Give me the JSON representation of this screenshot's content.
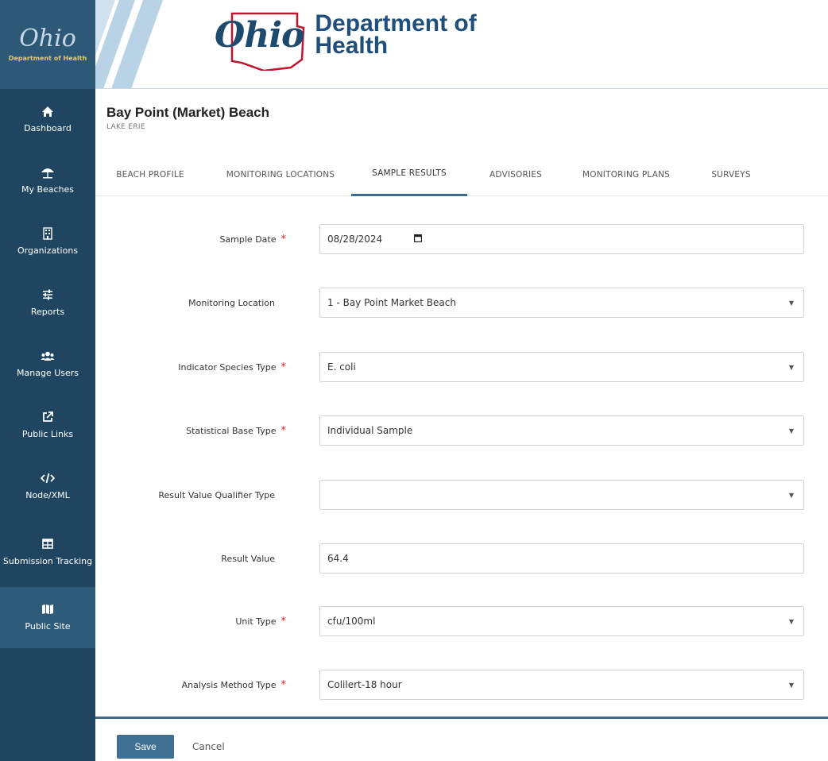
{
  "sidebar": {
    "logo_word": "Ohio",
    "logo_sub": "Department of Health",
    "items": [
      {
        "label": "Dashboard",
        "icon": "home-icon"
      },
      {
        "label": "My Beaches",
        "icon": "umbrella-icon"
      },
      {
        "label": "Organizations",
        "icon": "building-icon"
      },
      {
        "label": "Reports",
        "icon": "sliders-icon"
      },
      {
        "label": "Manage Users",
        "icon": "users-icon"
      },
      {
        "label": "Public Links",
        "icon": "external-link-icon"
      },
      {
        "label": "Node/XML",
        "icon": "code-icon"
      },
      {
        "label": "Submission Tracking",
        "icon": "table-icon"
      },
      {
        "label": "Public Site",
        "icon": "map-icon"
      }
    ]
  },
  "header": {
    "ohio_word": "Ohio",
    "department_line1": "Department of",
    "department_line2": "Health"
  },
  "page": {
    "title": "Bay Point (Market) Beach",
    "subtitle": "LAKE ERIE"
  },
  "tabs": [
    {
      "label": "BEACH PROFILE",
      "active": false
    },
    {
      "label": "MONITORING LOCATIONS",
      "active": false
    },
    {
      "label": "SAMPLE RESULTS",
      "active": true
    },
    {
      "label": "ADVISORIES",
      "active": false
    },
    {
      "label": "MONITORING PLANS",
      "active": false
    },
    {
      "label": "SURVEYS",
      "active": false
    }
  ],
  "form": {
    "sample_date": {
      "label": "Sample Date",
      "value": "08/28/2024",
      "required": true
    },
    "monitoring_location": {
      "label": "Monitoring Location",
      "value": "1 - Bay Point Market Beach",
      "required": false
    },
    "indicator_species": {
      "label": "Indicator Species Type",
      "value": "E. coli",
      "required": true
    },
    "statistical_base": {
      "label": "Statistical Base Type",
      "value": "Individual Sample",
      "required": true
    },
    "result_value_qualifier": {
      "label": "Result Value Qualifier Type",
      "value": "",
      "required": false
    },
    "result_value": {
      "label": "Result Value",
      "value": "64.4",
      "required": false
    },
    "unit_type": {
      "label": "Unit Type",
      "value": "cfu/100ml",
      "required": true
    },
    "analysis_method": {
      "label": "Analysis Method Type",
      "value": "Colilert-18 hour",
      "required": true
    }
  },
  "footer": {
    "save_label": "Save",
    "cancel_label": "Cancel"
  },
  "colors": {
    "sidebar_bg": "#1f4560",
    "sidebar_active": "#2f5b7a",
    "accent": "#3f6f92",
    "required": "#d0232b"
  }
}
